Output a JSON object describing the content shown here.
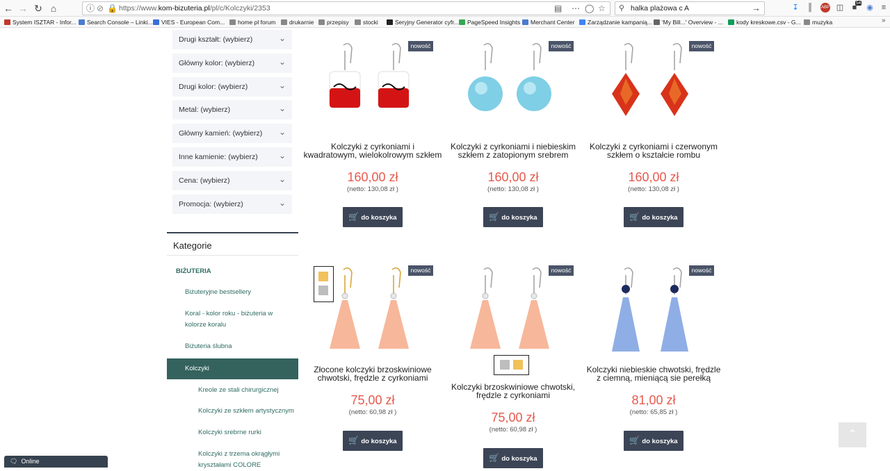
{
  "browser": {
    "url_prefix": "https://www.",
    "url_domain": "kom-bizuteria.pl",
    "url_path": "/pl/c/Kolczyki/2353",
    "search_value": "halka plażowa c A",
    "downloads_badge": "54",
    "bookmarks": [
      {
        "label": "System ISZTAR - Infor...",
        "color": "#c0392b"
      },
      {
        "label": "Search Console – Linki...",
        "color": "#4a7bd0"
      },
      {
        "label": "VIES - European Com...",
        "color": "#3b6fd8"
      },
      {
        "label": "home pl forum",
        "color": "#888"
      },
      {
        "label": "drukarnie",
        "color": "#888"
      },
      {
        "label": "przepisy",
        "color": "#888"
      },
      {
        "label": "stocki",
        "color": "#888"
      },
      {
        "label": "Seryjny Generator cyfr...",
        "color": "#222"
      },
      {
        "label": "PageSpeed Insights",
        "color": "#34a853"
      },
      {
        "label": "Merchant Center",
        "color": "#4a7bd0"
      },
      {
        "label": "Zarządzanie kampanią...",
        "color": "#4285f4"
      },
      {
        "label": "'My Bill...' Overview - ...",
        "color": "#666"
      },
      {
        "label": "kody kreskowe.csv - G...",
        "color": "#0f9d58"
      },
      {
        "label": "muzyka",
        "color": "#888"
      }
    ]
  },
  "filters": [
    "Drugi kształt: (wybierz)",
    "Główny kolor: (wybierz)",
    "Drugi kolor: (wybierz)",
    "Metal: (wybierz)",
    "Główny kamień: (wybierz)",
    "Inne kamienie: (wybierz)",
    "Cena: (wybierz)",
    "Promocja: (wybierz)"
  ],
  "categories": {
    "title": "Kategorie",
    "root": "BIŻUTERIA",
    "items": [
      "Biżuteryjne bestsellery",
      "Koral - kolor roku - biżuteria w kolorze koralu",
      "Biżuteria ślubna",
      "Kolczyki",
      "Kreole ze stali chirurgicznej",
      "Kolczyki ze szkłem artystycznym",
      "Kolczyki srebrne rurki",
      "Kolczyki z trzema okrągłymi kryształami COLORE"
    ]
  },
  "products": [
    {
      "badge": "nowość",
      "name": "Kolczyki z cyrkoniami i kwadratowym, wielokolrowym szkłem",
      "price": "160,00 zł",
      "netto": "(netto: 130,08 zł )",
      "button": "do koszyka"
    },
    {
      "badge": "nowość",
      "name": "Kolczyki z cyrkoniami i niebieskim szkłem z zatopionym srebrem",
      "price": "160,00 zł",
      "netto": "(netto: 130,08 zł )",
      "button": "do koszyka"
    },
    {
      "badge": "nowość",
      "name": "Kolczyki z cyrkoniami i czerwonym szkłem o kształcie rombu",
      "price": "160,00 zł",
      "netto": "(netto: 130,08 zł )",
      "button": "do koszyka"
    },
    {
      "badge": "nowość",
      "name": "Złocone kolczyki brzoskwiniowe chwotski, frędzle z cyrkoniami",
      "price": "75,00 zł",
      "netto": "(netto: 60,98 zł )",
      "button": "do koszyka"
    },
    {
      "badge": "nowość",
      "name": "Kolczyki brzoskwiniowe chwotski, frędzle z cyrkoniami",
      "price": "75,00 zł",
      "netto": "(netto: 60,98 zł )",
      "button": "do koszyka"
    },
    {
      "badge": "nowość",
      "name": "Kolczyki niebieskie chwotski, frędzle z ciemną, mieniącą sie perełką",
      "price": "81,00 zł",
      "netto": "(netto: 65,85 zł )",
      "button": "do koszyka"
    }
  ],
  "chat": {
    "label": "Online"
  },
  "colors": {
    "accent": "#34625d",
    "price": "#e55a4e",
    "button": "#3c4556",
    "badge": "#4a5468"
  }
}
